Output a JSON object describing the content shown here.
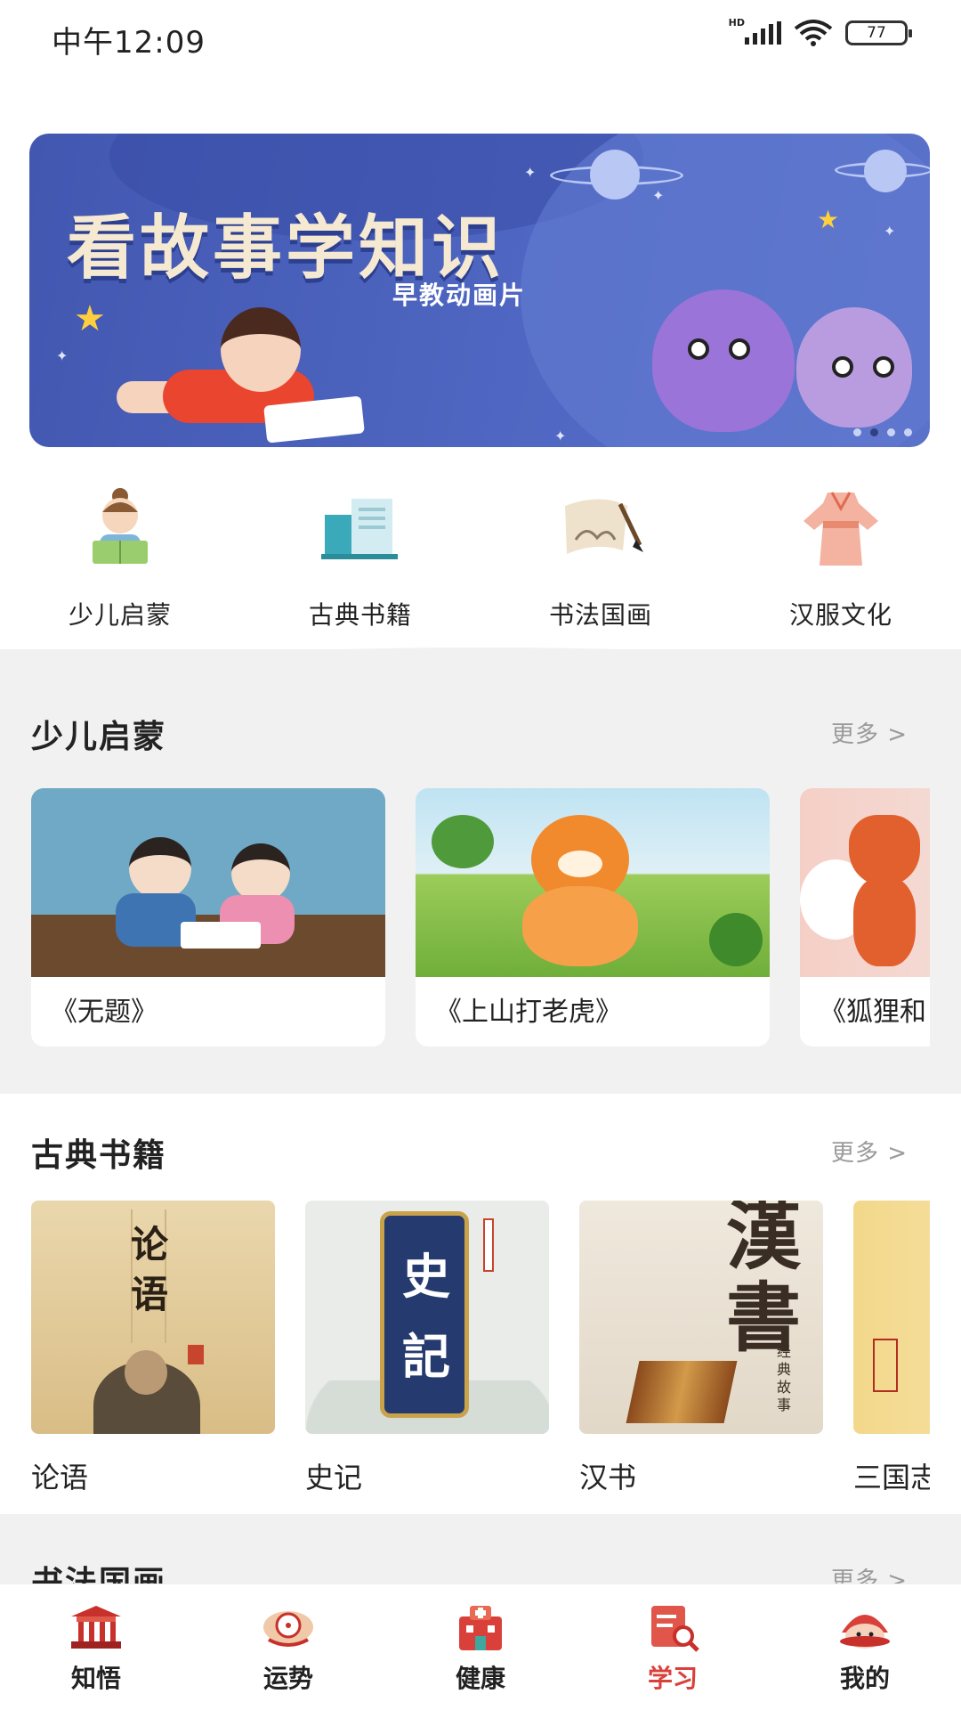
{
  "status_bar": {
    "time": "中午12:09",
    "network": "HD",
    "battery": "77"
  },
  "banner": {
    "title": "看故事学知识",
    "subtitle": "早教动画片",
    "page_count": 4,
    "active_page": 1
  },
  "categories": [
    {
      "label": "少儿启蒙",
      "icon": "child-reading-icon"
    },
    {
      "label": "古典书籍",
      "icon": "classic-books-icon"
    },
    {
      "label": "书法国画",
      "icon": "calligraphy-scroll-icon"
    },
    {
      "label": "汉服文化",
      "icon": "hanfu-dress-icon"
    }
  ],
  "section_enlightenment": {
    "title": "少儿启蒙",
    "more": "更多 >",
    "items": [
      {
        "title": "《无题》"
      },
      {
        "title": "《上山打老虎》"
      },
      {
        "title": "《狐狸和"
      }
    ]
  },
  "section_classics": {
    "title": "古典书籍",
    "more": "更多 >",
    "items": [
      {
        "name": "论语",
        "cover_text": "论语"
      },
      {
        "name": "史记",
        "cover_text": "史記"
      },
      {
        "name": "汉书",
        "cover_text": "漢書",
        "cover_sub": "经典故事"
      },
      {
        "name": "三国志"
      }
    ]
  },
  "section_painting": {
    "title": "书法国画",
    "more": "更多 >"
  },
  "tab_bar": {
    "active": "学习",
    "tabs": [
      {
        "label": "知悟",
        "icon": "temple-icon"
      },
      {
        "label": "运势",
        "icon": "compass-icon"
      },
      {
        "label": "健康",
        "icon": "hospital-icon"
      },
      {
        "label": "学习",
        "icon": "document-search-icon"
      },
      {
        "label": "我的",
        "icon": "mascot-icon"
      }
    ]
  },
  "colors": {
    "accent": "#d9403a",
    "banner_bg": "#4a60bd",
    "page_bg": "#f1f1f1"
  }
}
